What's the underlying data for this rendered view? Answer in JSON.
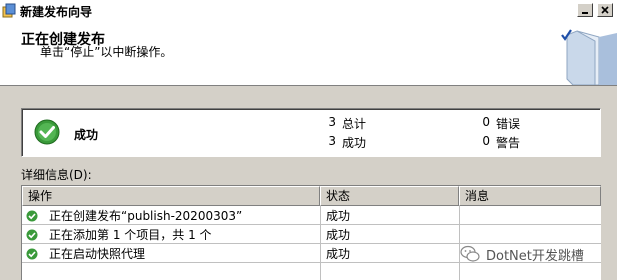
{
  "window": {
    "title": "新建发布向导"
  },
  "header": {
    "title": "正在创建发布",
    "subtitle": "单击“停止”以中断操作。"
  },
  "summary": {
    "status": "成功",
    "stats": [
      {
        "count": "3",
        "label": "总计"
      },
      {
        "count": "3",
        "label": "成功"
      },
      {
        "count": "0",
        "label": "错误"
      },
      {
        "count": "0",
        "label": "警告"
      }
    ]
  },
  "details": {
    "label": "详细信息(D):",
    "columns": [
      "操作",
      "状态",
      "消息"
    ],
    "rows": [
      {
        "action": "正在创建发布“publish-20200303”",
        "status": "成功",
        "message": ""
      },
      {
        "action": "正在添加第 1 个项目，共 1 个",
        "status": "成功",
        "message": ""
      },
      {
        "action": "正在启动快照代理",
        "status": "成功",
        "message": ""
      }
    ]
  },
  "watermark": {
    "text": "DotNet开发跳槽"
  },
  "colors": {
    "success_green": "#3a9a3a",
    "header_bg": "#ffffff",
    "dialog_bg": "#d4d0c8"
  },
  "icons": [
    "app-icon",
    "minimize-icon",
    "close-icon",
    "book-icon",
    "success-check-icon",
    "wechat-logo"
  ]
}
